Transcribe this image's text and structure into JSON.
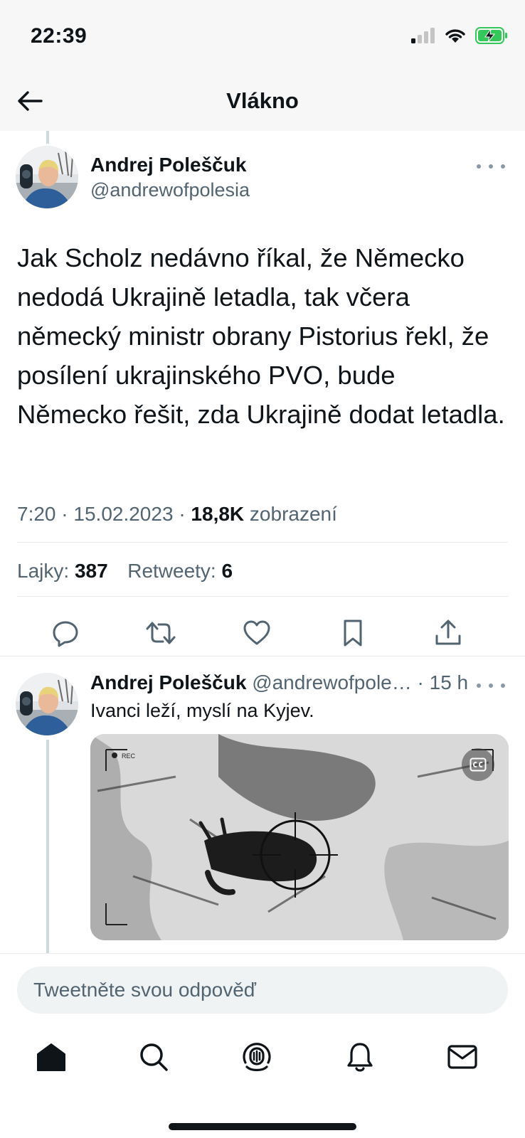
{
  "status_bar": {
    "time": "22:39"
  },
  "nav": {
    "title": "Vlákno"
  },
  "main_tweet": {
    "author_name": "Andrej Poleščuk",
    "author_handle": "@andrewofpolesia",
    "text": "Jak Scholz nedávno říkal, že Německo nedodá Ukrajině letadla, tak včera německý ministr obrany Pistorius řekl, že posílení ukrajinského PVO, bude Německo řešit, zda Ukrajině dodat letadla.",
    "time": "7:20",
    "date": "15.02.2023",
    "views_count": "18,8K",
    "views_label": "zobrazení",
    "likes_label": "Lajky:",
    "likes_count": "387",
    "retweets_label": "Retweety:",
    "retweets_count": "6"
  },
  "reply_tweet": {
    "author_name": "Andrej Poleščuk",
    "author_handle": "@andrewofpole…",
    "age": "15 h",
    "text": "Ivanci leží, myslí na Kyjev.",
    "media_overlay_label": "REC"
  },
  "compose": {
    "placeholder": "Tweetněte svou odpověď"
  },
  "icons": {
    "back": "arrow-left-icon",
    "more": "more-horizontal-icon",
    "reply": "reply-icon",
    "retweet": "retweet-icon",
    "like": "heart-icon",
    "bookmark": "bookmark-icon",
    "share": "share-icon",
    "home": "home-icon",
    "search": "search-icon",
    "spaces": "spaces-icon",
    "notifications": "bell-icon",
    "messages": "mail-icon"
  },
  "colors": {
    "text_primary": "#0f1419",
    "text_secondary": "#536471",
    "divider": "#e6ecf0",
    "battery_green": "#34c759"
  }
}
